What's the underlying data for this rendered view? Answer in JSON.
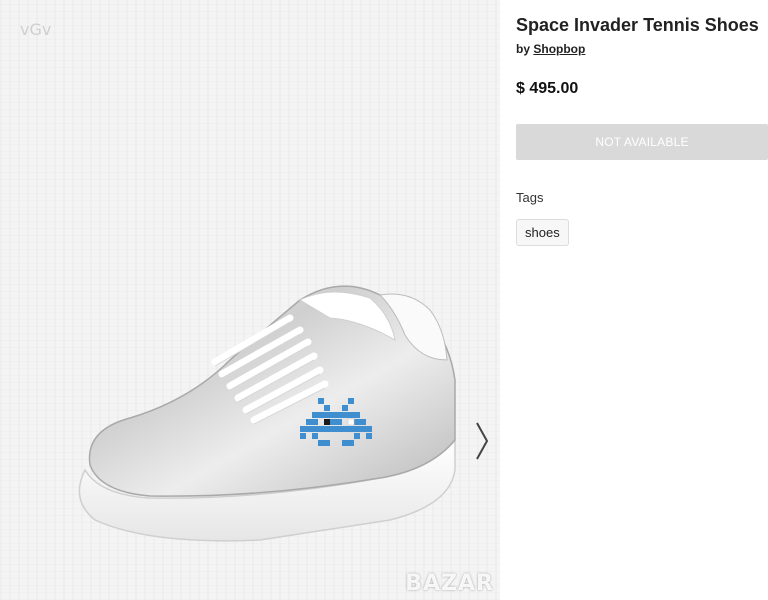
{
  "product": {
    "title": "Space Invader Tennis Shoes",
    "by_prefix": "by",
    "seller": "Shopbop",
    "price": "$ 495.00",
    "availability_button": "NOT AVAILABLE",
    "tags_label": "Tags",
    "tags": [
      "shoes"
    ]
  },
  "gallery": {
    "image_alt": "Silver leather sneaker with blue space invader pixel design",
    "next_icon": "chevron-right-icon"
  },
  "watermarks": {
    "top_left": "vGv",
    "bottom_right": "BAZAR"
  },
  "colors": {
    "button_disabled_bg": "#d9d9d9",
    "invader_blue": "#3f8fd0",
    "accent_text": "#222222"
  }
}
